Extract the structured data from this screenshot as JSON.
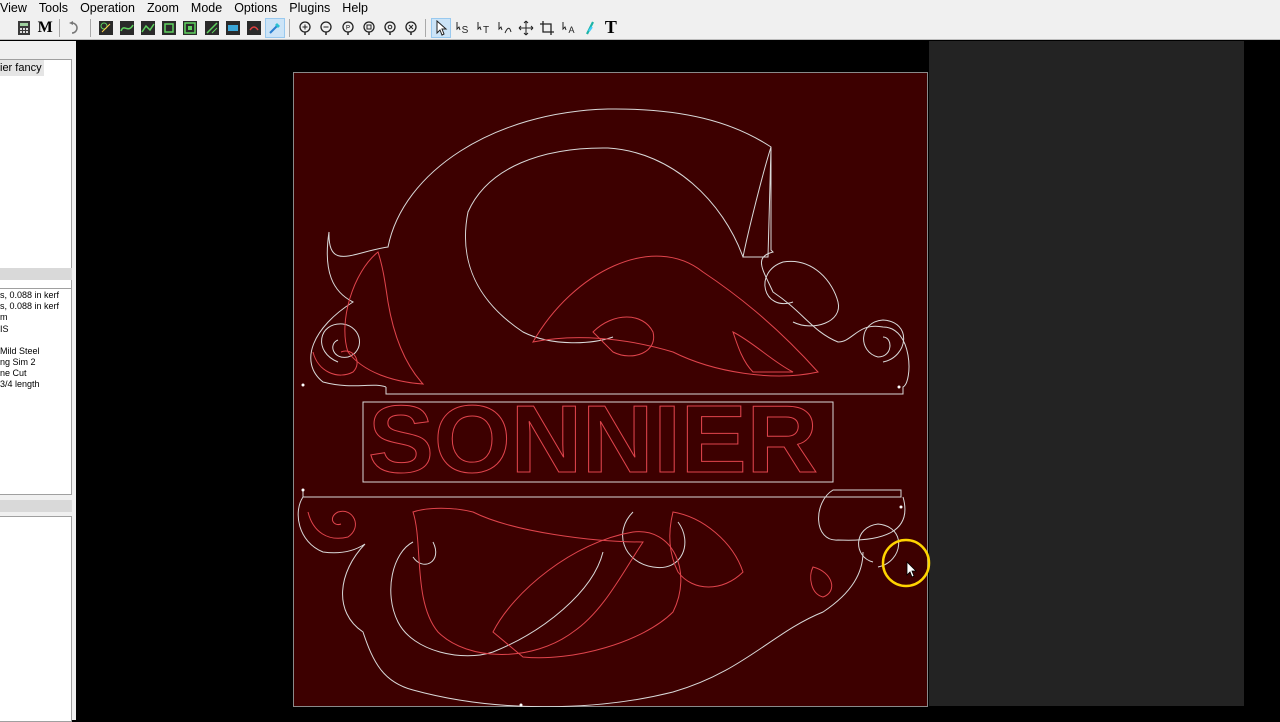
{
  "menu": [
    "View",
    "Tools",
    "Operation",
    "Zoom",
    "Mode",
    "Options",
    "Plugins",
    "Help"
  ],
  "toolbar": {
    "buttons": [
      "calculator-icon",
      "m-letter-icon",
      "undo-icon",
      "part-icon",
      "path-icon",
      "lead-icon",
      "outline-icon",
      "tab-icon",
      "sheet-icon",
      "nest-icon",
      "probe-icon",
      "zoom-plus-icon",
      "zoom-minus-icon",
      "zoom-fit-icon",
      "zoom-window-icon",
      "zoom-prev-icon",
      "zoom-all-icon",
      "select-arrow-icon",
      "select-path-icon",
      "select-text-icon",
      "node-edit-icon",
      "move-icon",
      "crop-icon",
      "text-path-icon",
      "feather-icon",
      "text-tool-icon"
    ],
    "m_label": "M",
    "t_label": "T"
  },
  "left_panel": {
    "part_name": "ier fancy",
    "info_lines": [
      "s, 0.088 in kerf",
      "s, 0.088 in kerf",
      "m",
      "IS",
      "",
      "Mild Steel",
      "ng Sim 2",
      "ne Cut",
      "3/4 length"
    ]
  },
  "drawing": {
    "text": "SONNIER",
    "sheet_color": "#3d0000",
    "outline_color": "#d9d9d9",
    "inner_color": "#e0444c"
  }
}
